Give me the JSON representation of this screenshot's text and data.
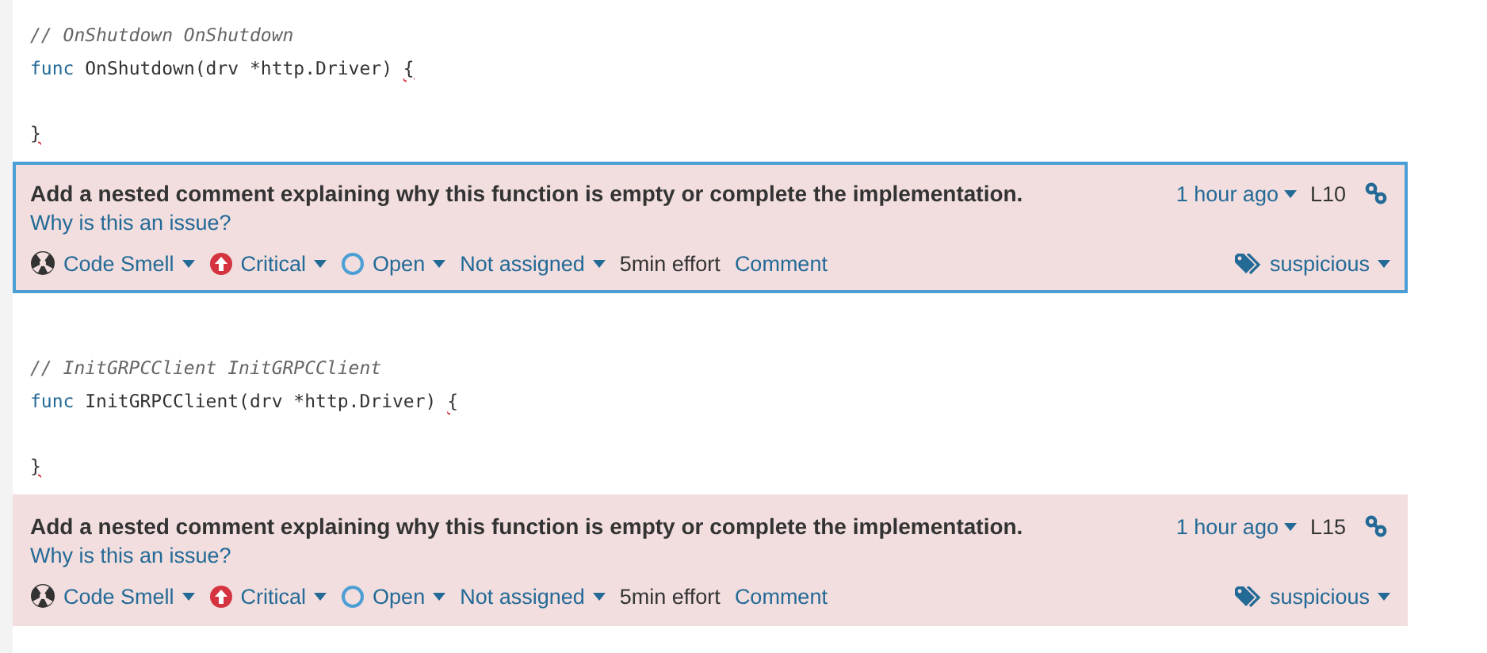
{
  "blocks": [
    {
      "code_lines": [
        {
          "kind": "comment",
          "text": "// OnShutdown OnShutdown"
        },
        {
          "kind": "code",
          "keyword": "func",
          "text": " OnShutdown(drv *http.Driver) ",
          "marked": "{"
        },
        {
          "kind": "blank"
        },
        {
          "kind": "code",
          "marked": "}"
        }
      ],
      "issue": {
        "selected": true,
        "message": "Add a nested comment explaining why this function is empty or complete the implementation.",
        "why_link": "Why is this an issue?",
        "type": "Code Smell",
        "severity": "Critical",
        "status": "Open",
        "assignee": "Not assigned",
        "effort": "5min effort",
        "comment": "Comment",
        "age": "1 hour ago",
        "line": "L10",
        "tag": "suspicious"
      }
    },
    {
      "code_lines": [
        {
          "kind": "comment",
          "text": "// InitGRPCClient InitGRPCClient"
        },
        {
          "kind": "code",
          "keyword": "func",
          "text": " InitGRPCClient(drv *http.Driver) ",
          "marked": "{"
        },
        {
          "kind": "blank"
        },
        {
          "kind": "code",
          "marked": "}"
        }
      ],
      "issue": {
        "selected": false,
        "message": "Add a nested comment explaining why this function is empty or complete the implementation.",
        "why_link": "Why is this an issue?",
        "type": "Code Smell",
        "severity": "Critical",
        "status": "Open",
        "assignee": "Not assigned",
        "effort": "5min effort",
        "comment": "Comment",
        "age": "1 hour ago",
        "line": "L15",
        "tag": "suspicious"
      }
    }
  ]
}
